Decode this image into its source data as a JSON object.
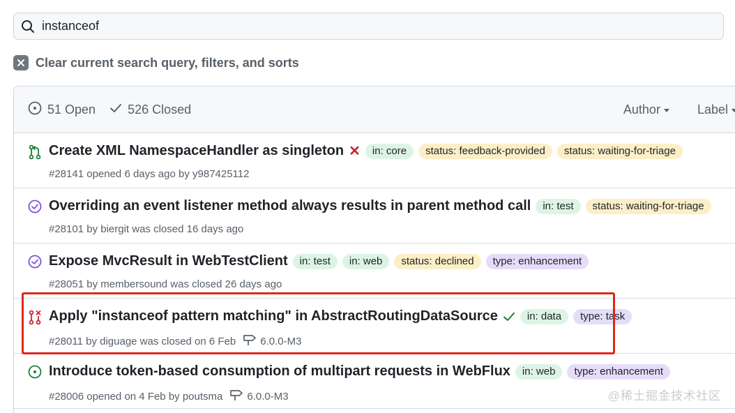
{
  "search": {
    "value": "instanceof",
    "icon": "search-icon"
  },
  "clear": {
    "label": "Clear current search query, filters, and sorts"
  },
  "header": {
    "open_label": "51 Open",
    "closed_label": "526 Closed",
    "author_label": "Author",
    "label_label": "Label"
  },
  "issues": [
    {
      "title": "Create XML NamespaceHandler as singleton",
      "meta": "#28141 opened 6 days ago by y987425112",
      "status": "x",
      "labels": [
        {
          "text": "in: core",
          "color": "#ddf4e4"
        },
        {
          "text": "status: feedback-provided",
          "color": "#fcefc7"
        },
        {
          "text": "status: waiting-for-triage",
          "color": "#fcefc7"
        }
      ]
    },
    {
      "title": "Overriding an event listener method always results in parent method call",
      "meta": "#28101 by biergit was closed 16 days ago",
      "labels": [
        {
          "text": "in: test",
          "color": "#ddf4e4"
        },
        {
          "text": "status: waiting-for-triage",
          "color": "#fcefc7"
        }
      ]
    },
    {
      "title": "Expose MvcResult in WebTestClient",
      "meta": "#28051 by membersound was closed 26 days ago",
      "labels": [
        {
          "text": "in: test",
          "color": "#ddf4e4"
        },
        {
          "text": "in: web",
          "color": "#ddf4e4"
        },
        {
          "text": "status: declined",
          "color": "#fcefc7"
        },
        {
          "text": "type: enhancement",
          "color": "#e5dcf9"
        }
      ]
    },
    {
      "title": "Apply \"instanceof pattern matching\" in AbstractRoutingDataSource",
      "meta": "#28011 by diguage was closed on 6 Feb",
      "milestone": "6.0.0-M3",
      "status": "check",
      "labels": [
        {
          "text": "in: data",
          "color": "#ddf4e4"
        },
        {
          "text": "type: task",
          "color": "#e5dcf9"
        }
      ]
    },
    {
      "title": "Introduce token-based consumption of multipart requests in WebFlux",
      "meta": "#28006 opened on 4 Feb by poutsma",
      "milestone": "6.0.0-M3",
      "labels": [
        {
          "text": "in: web",
          "color": "#ddf4e4"
        },
        {
          "text": "type: enhancement",
          "color": "#e5dcf9"
        }
      ]
    }
  ],
  "watermark": "@稀土掘金技术社区",
  "colors": {
    "open": "#1a7f37",
    "closed": "#8250df",
    "merged": "#cf222e",
    "highlight": "#e0261b"
  }
}
